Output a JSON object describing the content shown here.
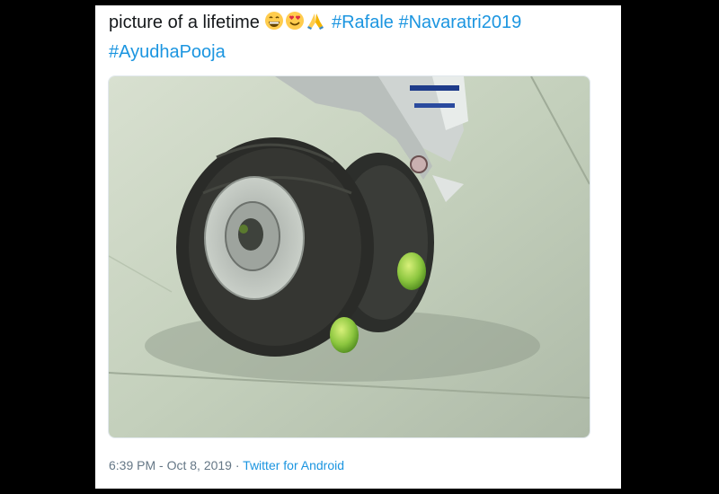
{
  "tweet": {
    "text_line1": "picture of a lifetime",
    "emojis": [
      "grinning-face-icon",
      "heart-eyes-icon",
      "folded-hands-icon"
    ],
    "hashtags": [
      "#Rafale",
      "#Navaratri2019",
      "#AyudhaPooja"
    ],
    "media": {
      "description_icon": "photo-landing-gear-with-lemons"
    },
    "timestamp": "6:39 PM - Oct 8, 2019",
    "separator": " · ",
    "source": "Twitter for Android"
  },
  "colors": {
    "link": "#1b95e0",
    "text": "#14171a",
    "meta": "#657786",
    "background": "#000000",
    "card": "#ffffff"
  }
}
